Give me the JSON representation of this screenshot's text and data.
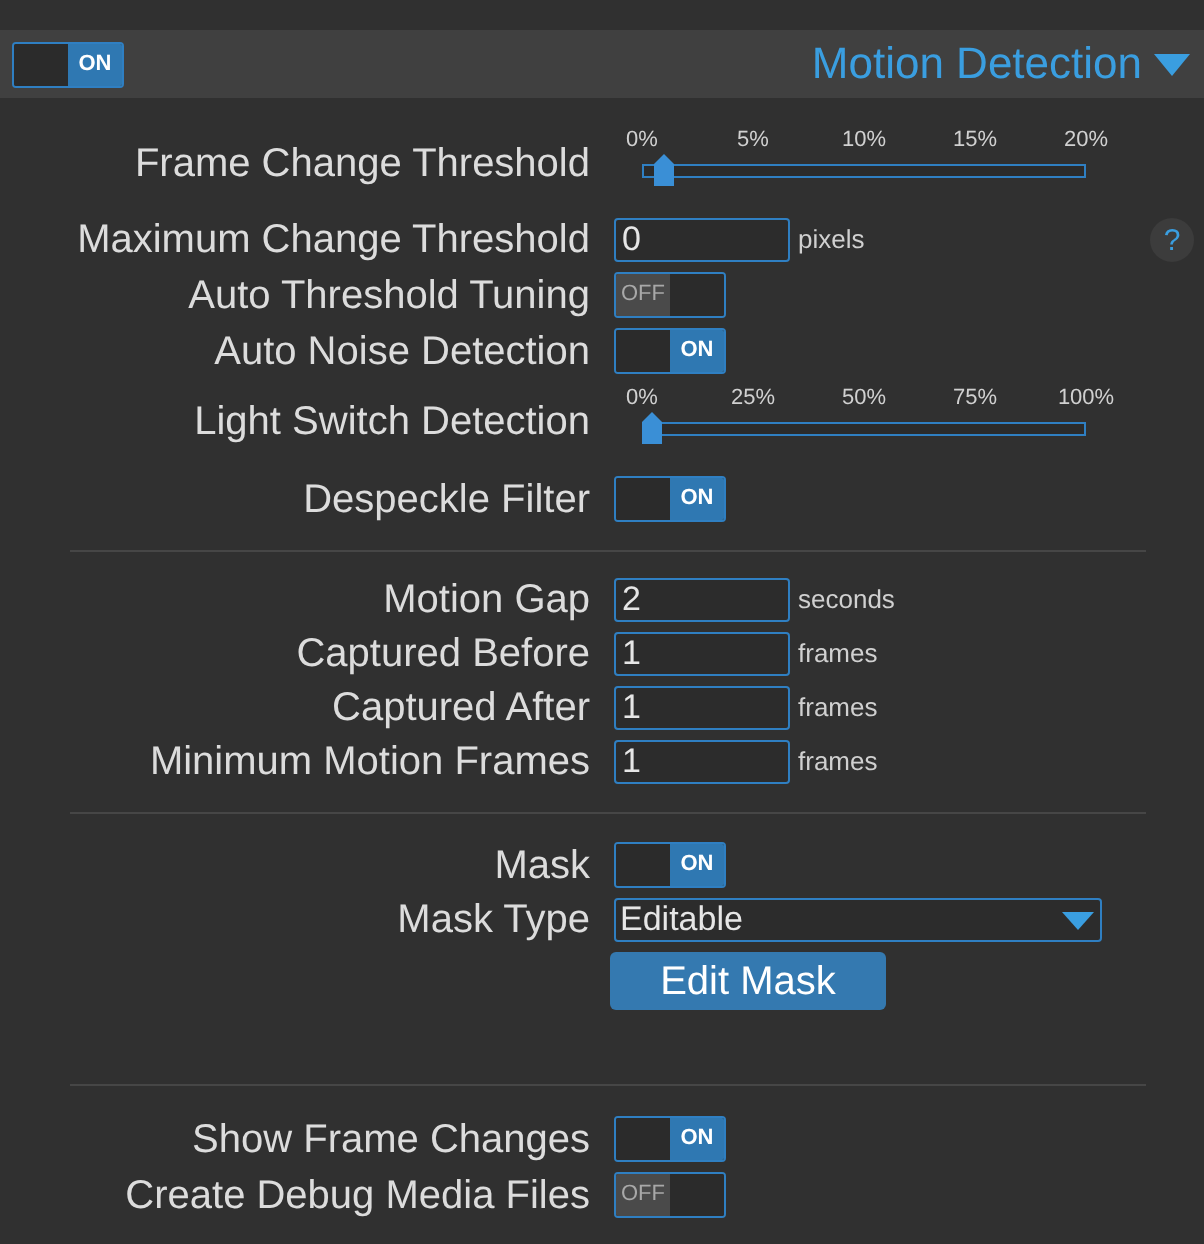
{
  "header": {
    "toggle": {
      "on": true,
      "text": "ON"
    },
    "title": "Motion Detection"
  },
  "sections": [
    {
      "rows": [
        {
          "kind": "slider",
          "label": "Frame Change Threshold",
          "ticks": [
            "0%",
            "5%",
            "10%",
            "15%",
            "20%"
          ],
          "level": 0.03
        },
        {
          "kind": "number",
          "label": "Maximum Change Threshold",
          "value": "0",
          "unit": "pixels",
          "help": "?"
        },
        {
          "kind": "toggle",
          "label": "Auto Threshold Tuning",
          "on": false,
          "text": "OFF"
        },
        {
          "kind": "toggle",
          "label": "Auto Noise Detection",
          "on": true,
          "text": "ON"
        },
        {
          "kind": "slider",
          "label": "Light Switch Detection",
          "ticks": [
            "0%",
            "25%",
            "50%",
            "75%",
            "100%"
          ],
          "level": 0
        },
        {
          "kind": "toggle",
          "label": "Despeckle Filter",
          "on": true,
          "text": "ON"
        }
      ]
    },
    {
      "rows": [
        {
          "kind": "number",
          "label": "Motion Gap",
          "value": "2",
          "unit": "seconds"
        },
        {
          "kind": "number",
          "label": "Captured Before",
          "value": "1",
          "unit": "frames"
        },
        {
          "kind": "number",
          "label": "Captured After",
          "value": "1",
          "unit": "frames"
        },
        {
          "kind": "number",
          "label": "Minimum Motion Frames",
          "value": "1",
          "unit": "frames"
        }
      ]
    },
    {
      "rows": [
        {
          "kind": "toggle",
          "label": "Mask",
          "on": true,
          "text": "ON"
        },
        {
          "kind": "select",
          "label": "Mask Type",
          "value": "Editable"
        },
        {
          "kind": "button",
          "label": "Edit Mask"
        }
      ]
    },
    {
      "rows": [
        {
          "kind": "toggle",
          "label": "Show Frame Changes",
          "on": true,
          "text": "ON"
        },
        {
          "kind": "toggle",
          "label": "Create Debug Media Files",
          "on": false,
          "text": "OFF"
        }
      ]
    }
  ]
}
